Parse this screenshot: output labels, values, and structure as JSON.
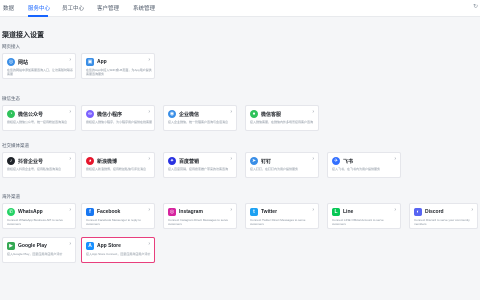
{
  "nav": {
    "items": [
      {
        "label": "数据",
        "active": false
      },
      {
        "label": "服务中心",
        "active": true
      },
      {
        "label": "员工中心",
        "active": false
      },
      {
        "label": "客户管理",
        "active": false
      },
      {
        "label": "系统管理",
        "active": false
      }
    ],
    "right_icon": "expand-icon"
  },
  "page_title": "渠道接入设置",
  "sections": [
    {
      "title": "网页接入",
      "cards": [
        {
          "name": "网站",
          "icon": "globe-icon",
          "color": "#3a8ee6",
          "desc": "在您的网站中添加客服咨询入口，让访客随时联系客服"
        },
        {
          "name": "App",
          "icon": "app-icon",
          "color": "#3a8ee6",
          "desc": "在您的App中接入SDK或H5页面，为App用户提供客服咨询服务"
        }
      ]
    },
    {
      "title": "微信生态",
      "cards": [
        {
          "name": "微信公众号",
          "icon": "wechat-official-icon",
          "color": "#2fc25b",
          "desc": "授权接入微信公众号，统一接待粉丝咨询消息"
        },
        {
          "name": "微信小程序",
          "icon": "wechat-mini-program-icon",
          "color": "#7b61ff",
          "desc": "授权接入微信小程序，为小程序用户提供在线客服"
        },
        {
          "name": "企业微信",
          "icon": "wecom-icon",
          "color": "#3a8ee6",
          "desc": "接入企业微信，统一管理客户咨询与会话消息"
        },
        {
          "name": "微信客服",
          "icon": "wechat-service-icon",
          "color": "#2fc25b",
          "desc": "接入微信客服，在微信内外多场景接待客户咨询"
        }
      ]
    },
    {
      "title": "社交媒体渠道",
      "cards": [
        {
          "name": "抖音企业号",
          "icon": "douyin-icon",
          "color": "#1f2329",
          "desc": "授权接入抖音企业号，接待私信咨询消息"
        },
        {
          "name": "新浪微博",
          "icon": "weibo-icon",
          "color": "#e6162d",
          "desc": "授权接入新浪微博，接待粉丝私信与评论消息"
        },
        {
          "name": "百度营销",
          "icon": "baidu-icon",
          "color": "#2932e1",
          "desc": "接入百度营销，接待搜索推广带来的访客咨询"
        },
        {
          "name": "钉钉",
          "icon": "dingtalk-icon",
          "color": "#3a8ee6",
          "desc": "接入钉钉，在钉钉内为用户提供服务"
        },
        {
          "name": "飞书",
          "icon": "feishu-icon",
          "color": "#3370ff",
          "desc": "接入飞书，在飞书内为用户提供服务"
        }
      ]
    },
    {
      "title": "海外渠道",
      "cards": [
        {
          "name": "WhatsApp",
          "icon": "whatsapp-icon",
          "color": "#25d366",
          "desc": "Connect WhatsApp Business API to serve customers"
        },
        {
          "name": "Facebook",
          "icon": "facebook-icon",
          "color": "#1877f2",
          "desc": "Connect Facebook Messenger to reply to customers"
        },
        {
          "name": "Instagram",
          "icon": "instagram-icon",
          "color": "#d6249f",
          "desc": "Connect Instagram Direct Messages to serve customers"
        },
        {
          "name": "Twitter",
          "icon": "twitter-icon",
          "color": "#1da1f2",
          "desc": "Connect Twitter Direct Messages to serve customers"
        },
        {
          "name": "Line",
          "icon": "line-icon",
          "color": "#06c755",
          "desc": "Connect LINE Official Account to serve customers"
        },
        {
          "name": "Discord",
          "icon": "discord-icon",
          "color": "#5865f2",
          "desc": "Connect Discord to serve your community members"
        },
        {
          "name": "Google Play",
          "icon": "google-play-icon",
          "color": "#34a853",
          "desc": "接入Google Play，回复应用商店用户评价"
        },
        {
          "name": "App Store",
          "icon": "app-store-icon",
          "color": "#1890ff",
          "desc": "接入App Store Connect，回复应用商店用户评价",
          "selected": true
        }
      ]
    }
  ]
}
